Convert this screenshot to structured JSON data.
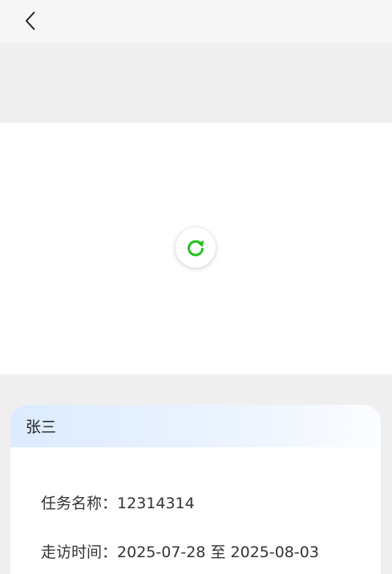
{
  "card": {
    "name": "张三",
    "rows": [
      {
        "label": "任务名称：",
        "value": "12314314"
      },
      {
        "label": "走访时间：",
        "value": "2025-07-28 至 2025-08-03"
      }
    ]
  },
  "icons": {
    "back": "chevron-left-icon",
    "refresh": "refresh-icon"
  },
  "colors": {
    "accent": "#21c21c",
    "header_gradient_start": "#dcebff"
  }
}
